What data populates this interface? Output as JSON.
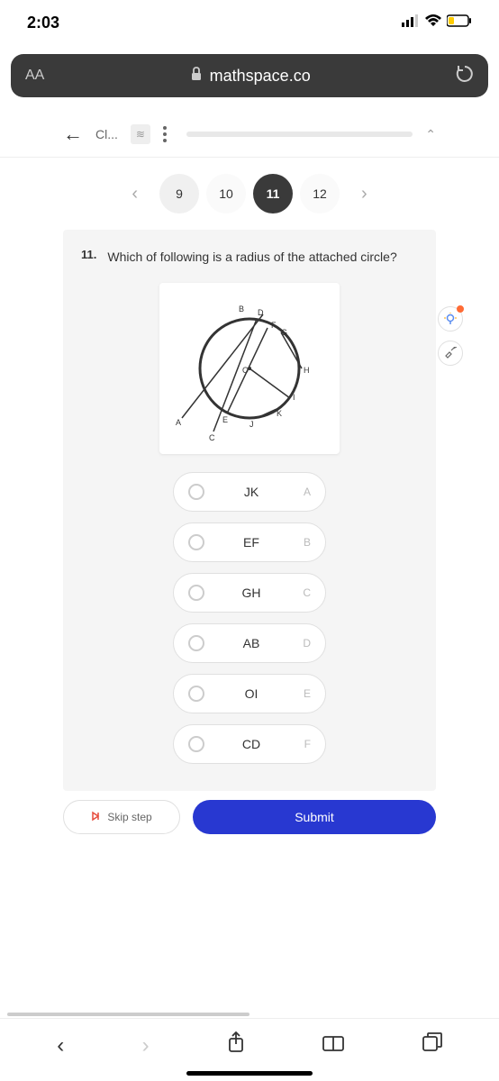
{
  "status": {
    "time": "2:03"
  },
  "address": {
    "aa": "AA",
    "url": "mathspace.co"
  },
  "topnav": {
    "label": "Cl..."
  },
  "qnav": {
    "items": [
      "9",
      "10",
      "11",
      "12"
    ],
    "active_index": 2
  },
  "question": {
    "number": "11.",
    "text": "Which of following is a radius of the attached circle?"
  },
  "diagram": {
    "labels": [
      "A",
      "B",
      "C",
      "D",
      "E",
      "F",
      "G",
      "H",
      "I",
      "J",
      "K",
      "O"
    ]
  },
  "options": [
    {
      "text": "JK",
      "letter": "A"
    },
    {
      "text": "EF",
      "letter": "B"
    },
    {
      "text": "GH",
      "letter": "C"
    },
    {
      "text": "AB",
      "letter": "D"
    },
    {
      "text": "OI",
      "letter": "E"
    },
    {
      "text": "CD",
      "letter": "F"
    }
  ],
  "actions": {
    "skip": "Skip step",
    "submit": "Submit"
  }
}
